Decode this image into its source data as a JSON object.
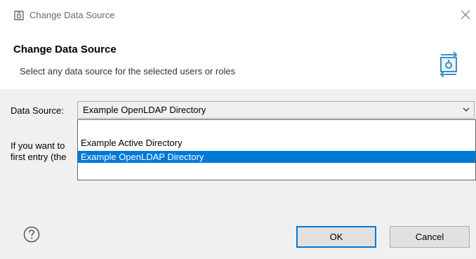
{
  "window": {
    "title": "Change Data Source",
    "close_icon": "close-icon"
  },
  "header": {
    "title": "Change Data Source",
    "subtitle": "Select any data source for the selected users or roles"
  },
  "form": {
    "data_source_label": "Data Source:",
    "data_source_value": "Example OpenLDAP Directory",
    "description_line1": "If you want to",
    "description_line2": "first entry (the"
  },
  "dropdown": {
    "options": [
      "Example Active Directory",
      "Example OpenLDAP Directory"
    ],
    "selected_index": 1
  },
  "buttons": {
    "ok": "OK",
    "cancel": "Cancel"
  },
  "colors": {
    "selection": "#0078d7",
    "dialog_bg": "#f0f0f0",
    "header_bg": "#ffffff"
  }
}
